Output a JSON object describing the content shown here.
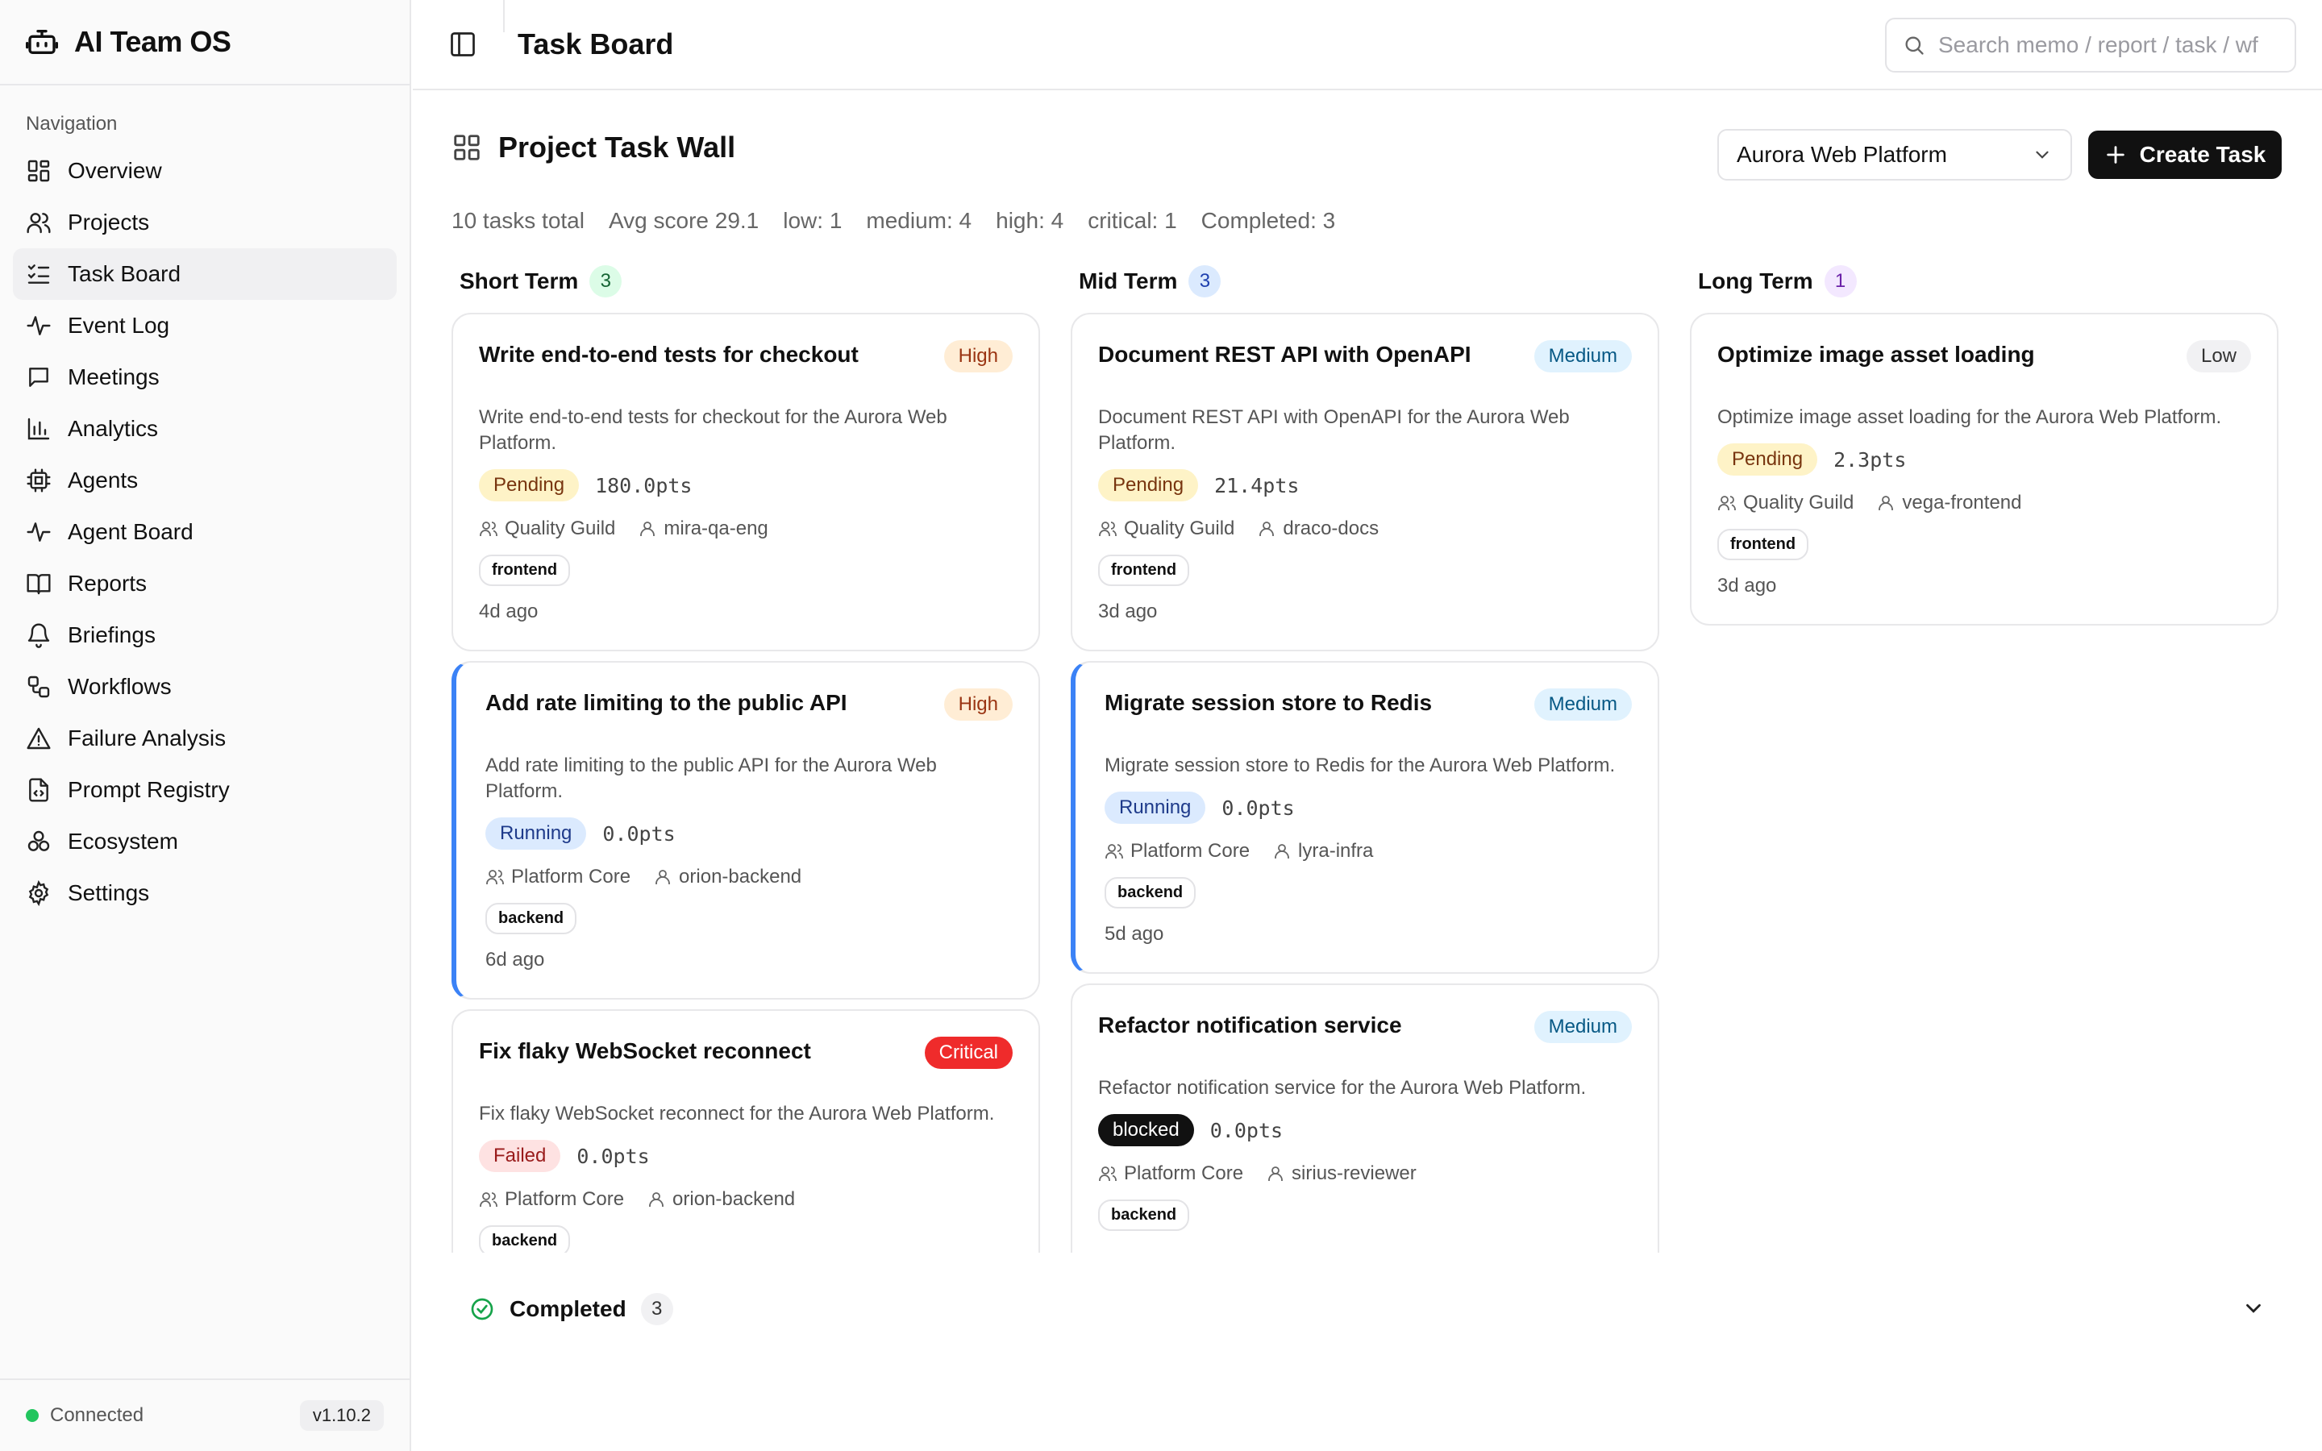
{
  "app": {
    "name": "AI Team OS",
    "version": "v1.10.2",
    "connection": "Connected"
  },
  "sidebar": {
    "heading": "Navigation",
    "items": [
      {
        "label": "Overview",
        "icon": "dashboard-icon"
      },
      {
        "label": "Projects",
        "icon": "users-icon"
      },
      {
        "label": "Task Board",
        "icon": "list-checks-icon",
        "active": true
      },
      {
        "label": "Event Log",
        "icon": "activity-icon"
      },
      {
        "label": "Meetings",
        "icon": "message-square-icon"
      },
      {
        "label": "Analytics",
        "icon": "bar-chart-icon"
      },
      {
        "label": "Agents",
        "icon": "cpu-icon"
      },
      {
        "label": "Agent Board",
        "icon": "activity-icon"
      },
      {
        "label": "Reports",
        "icon": "book-open-icon"
      },
      {
        "label": "Briefings",
        "icon": "bell-icon"
      },
      {
        "label": "Workflows",
        "icon": "workflow-icon"
      },
      {
        "label": "Failure Analysis",
        "icon": "alert-triangle-icon"
      },
      {
        "label": "Prompt Registry",
        "icon": "file-code-icon"
      },
      {
        "label": "Ecosystem",
        "icon": "boxes-icon"
      },
      {
        "label": "Settings",
        "icon": "gear-icon"
      }
    ]
  },
  "topbar": {
    "title": "Task Board",
    "search_placeholder": "Search memo / report / task / wf"
  },
  "main": {
    "title": "Project Task Wall",
    "project_select": "Aurora Web Platform",
    "create_label": "Create Task",
    "stats": {
      "total": "10 tasks total",
      "avg": "Avg score 29.1",
      "low": "low: 1",
      "medium": "medium: 4",
      "high": "high: 4",
      "critical": "critical: 1",
      "completed": "Completed: 3"
    },
    "columns": [
      {
        "title": "Short Term",
        "count": "3",
        "cards": [
          {
            "title": "Write end-to-end tests for checkout",
            "priority": "High",
            "desc": "Write end-to-end tests for checkout for the Aurora Web Platform.",
            "status": "Pending",
            "pts": "180.0pts",
            "team": "Quality Guild",
            "agent": "mira-qa-eng",
            "tag": "frontend",
            "ago": "4d ago"
          },
          {
            "title": "Add rate limiting to the public API",
            "priority": "High",
            "desc": "Add rate limiting to the public API for the Aurora Web Platform.",
            "status": "Running",
            "pts": "0.0pts",
            "team": "Platform Core",
            "agent": "orion-backend",
            "tag": "backend",
            "ago": "6d ago"
          },
          {
            "title": "Fix flaky WebSocket reconnect",
            "priority": "Critical",
            "desc": "Fix flaky WebSocket reconnect for the Aurora Web Platform.",
            "status": "Failed",
            "pts": "0.0pts",
            "team": "Platform Core",
            "agent": "orion-backend",
            "tag": "backend",
            "ago": ""
          }
        ]
      },
      {
        "title": "Mid Term",
        "count": "3",
        "cards": [
          {
            "title": "Document REST API with OpenAPI",
            "priority": "Medium",
            "desc": "Document REST API with OpenAPI for the Aurora Web Platform.",
            "status": "Pending",
            "pts": "21.4pts",
            "team": "Quality Guild",
            "agent": "draco-docs",
            "tag": "frontend",
            "ago": "3d ago"
          },
          {
            "title": "Migrate session store to Redis",
            "priority": "Medium",
            "desc": "Migrate session store to Redis for the Aurora Web Platform.",
            "status": "Running",
            "pts": "0.0pts",
            "team": "Platform Core",
            "agent": "lyra-infra",
            "tag": "backend",
            "ago": "5d ago"
          },
          {
            "title": "Refactor notification service",
            "priority": "Medium",
            "desc": "Refactor notification service for the Aurora Web Platform.",
            "status": "blocked",
            "pts": "0.0pts",
            "team": "Platform Core",
            "agent": "sirius-reviewer",
            "tag": "backend",
            "ago": ""
          }
        ]
      },
      {
        "title": "Long Term",
        "count": "1",
        "cards": [
          {
            "title": "Optimize image asset loading",
            "priority": "Low",
            "desc": "Optimize image asset loading for the Aurora Web Platform.",
            "status": "Pending",
            "pts": "2.3pts",
            "team": "Quality Guild",
            "agent": "vega-frontend",
            "tag": "frontend",
            "ago": "3d ago"
          }
        ]
      }
    ],
    "completed": {
      "label": "Completed",
      "count": "3"
    }
  }
}
